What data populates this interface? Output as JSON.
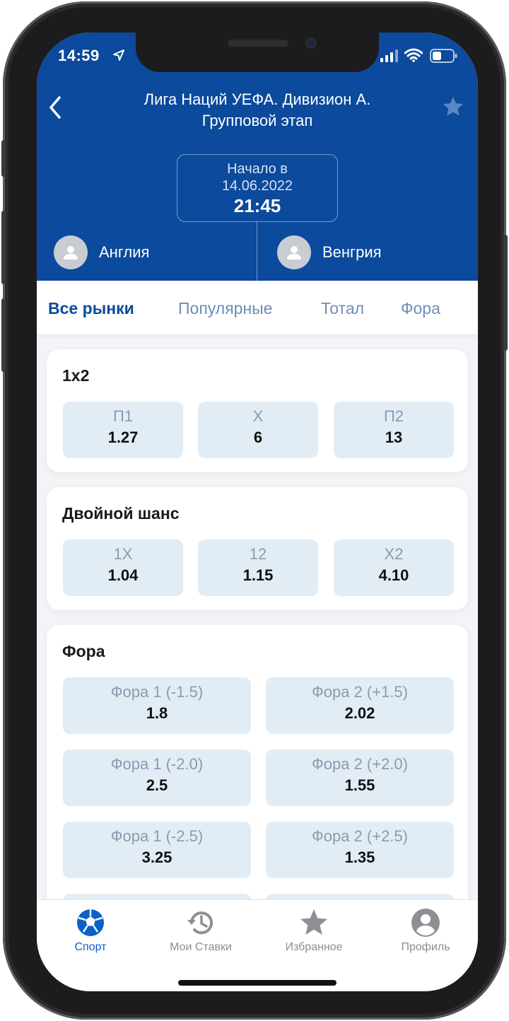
{
  "status_bar": {
    "time": "14:59"
  },
  "header": {
    "title_line1": "Лига Наций УЕФА. Дивизион А.",
    "title_line2": "Групповой этап",
    "start_label": "Начало в",
    "start_date": "14.06.2022",
    "start_time": "21:45",
    "team_home": "Англия",
    "team_away": "Венгрия"
  },
  "tabs": [
    {
      "label": "Все рынки",
      "active": true
    },
    {
      "label": "Популярные",
      "active": false
    },
    {
      "label": "Тотал",
      "active": false
    },
    {
      "label": "Фора",
      "active": false
    }
  ],
  "markets": {
    "m1x2": {
      "title": "1x2",
      "odds": [
        {
          "label": "П1",
          "value": "1.27"
        },
        {
          "label": "X",
          "value": "6"
        },
        {
          "label": "П2",
          "value": "13"
        }
      ]
    },
    "double_chance": {
      "title": "Двойной шанс",
      "odds": [
        {
          "label": "1X",
          "value": "1.04"
        },
        {
          "label": "12",
          "value": "1.15"
        },
        {
          "label": "X2",
          "value": "4.10"
        }
      ]
    },
    "handicap": {
      "title": "Фора",
      "odds": [
        {
          "label": "Фора 1 (-1.5)",
          "value": "1.8"
        },
        {
          "label": "Фора 2 (+1.5)",
          "value": "2.02"
        },
        {
          "label": "Фора 1 (-2.0)",
          "value": "2.5"
        },
        {
          "label": "Фора 2 (+2.0)",
          "value": "1.55"
        },
        {
          "label": "Фора 1 (-2.5)",
          "value": "3.25"
        },
        {
          "label": "Фора 2 (+2.5)",
          "value": "1.35"
        }
      ]
    }
  },
  "bottom_nav": [
    {
      "label": "Спорт",
      "icon": "soccer-ball-icon",
      "active": true
    },
    {
      "label": "Мои Ставки",
      "icon": "history-icon",
      "active": false
    },
    {
      "label": "Избранное",
      "icon": "star-icon",
      "active": false
    },
    {
      "label": "Профиль",
      "icon": "profile-icon",
      "active": false
    }
  ],
  "colors": {
    "header_bg": "#0b4a9c",
    "accent": "#0b61c6",
    "odd_bg": "#e2ecf5",
    "tab_inactive": "#6f8db7"
  }
}
